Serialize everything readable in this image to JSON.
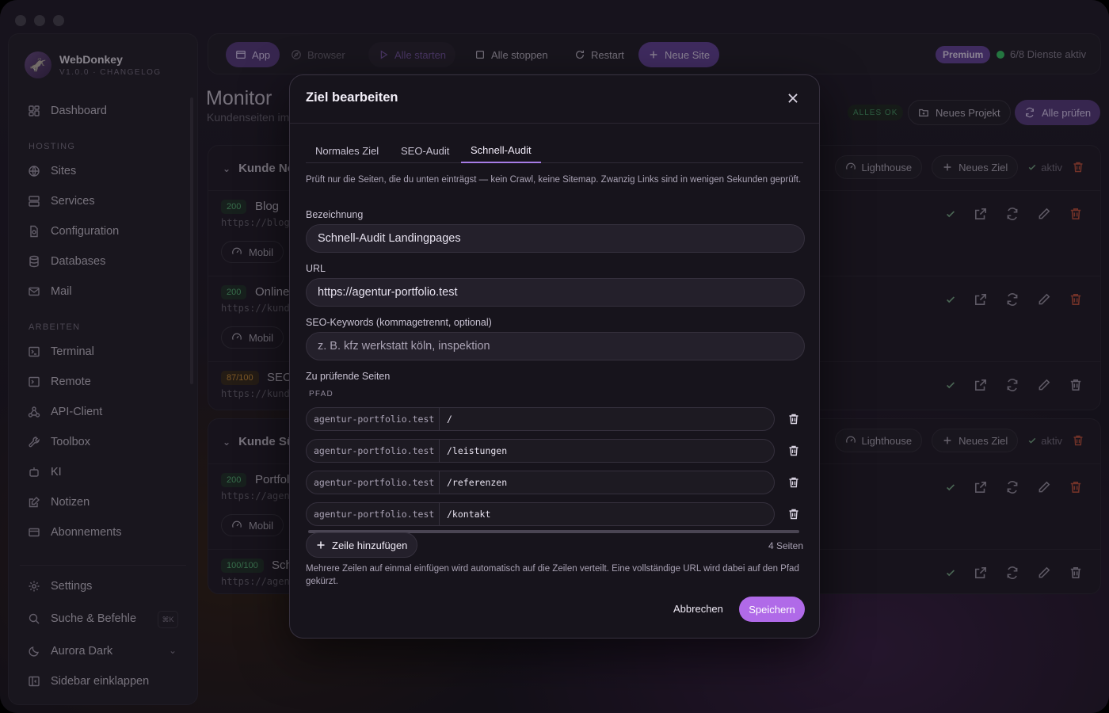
{
  "sidebar": {
    "app_name": "WebDonkey",
    "version": "V1.0.0 · CHANGELOG",
    "dashboard": "Dashboard",
    "section_hosting": "HOSTING",
    "sites": "Sites",
    "services": "Services",
    "configuration": "Configuration",
    "databases": "Databases",
    "mail": "Mail",
    "section_arbeiten": "ARBEITEN",
    "terminal": "Terminal",
    "remote": "Remote",
    "api_client": "API-Client",
    "toolbox": "Toolbox",
    "ki": "KI",
    "notizen": "Notizen",
    "abonnements": "Abonnements",
    "settings": "Settings",
    "search": "Suche & Befehle",
    "search_kbd": "⌘K",
    "theme": "Aurora Dark",
    "collapse": "Sidebar einklappen"
  },
  "toolbar": {
    "app": "App",
    "browser": "Browser",
    "start_all": "Alle starten",
    "stop_all": "Alle stoppen",
    "restart": "Restart",
    "new_site": "Neue Site",
    "premium": "Premium",
    "services_active": "6/8 Dienste aktiv"
  },
  "page": {
    "title": "Monitor",
    "subtitle": "Kundenseiten im",
    "status": "ALLES OK",
    "new_project": "Neues Projekt",
    "check_all": "Alle prüfen"
  },
  "groups": [
    {
      "name": "Kunde No",
      "lighthouse": "Lighthouse",
      "new_target": "Neues Ziel",
      "active": "aktiv",
      "rows": [
        {
          "status": "200",
          "name": "Blog",
          "extra": "1",
          "url": "https://blog.",
          "mode": "Mobil"
        },
        {
          "status": "200",
          "name": "Online",
          "url": "https://kunde",
          "mode": "Mobil"
        },
        {
          "status": "87/100",
          "name": "SEO",
          "url": "https://kunde"
        }
      ]
    },
    {
      "name": "Kunde Sü",
      "lighthouse": "Lighthouse",
      "new_target": "Neues Ziel",
      "active": "aktiv",
      "rows": [
        {
          "status": "200",
          "name": "Portfol",
          "url": "https://agent",
          "mode": "Mobil"
        },
        {
          "status": "100/100",
          "name": "Sch",
          "url": "https://agent"
        }
      ]
    }
  ],
  "modal": {
    "title": "Ziel bearbeiten",
    "tabs": [
      "Normales Ziel",
      "SEO-Audit",
      "Schnell-Audit"
    ],
    "active_tab": "Schnell-Audit",
    "description": "Prüft nur die Seiten, die du unten einträgst — kein Crawl, keine Sitemap. Zwanzig Links sind in wenigen Sekunden geprüft.",
    "name_label": "Bezeichnung",
    "name_value": "Schnell-Audit Landingpages",
    "url_label": "URL",
    "url_value": "https://agentur-portfolio.test",
    "keywords_label": "SEO-Keywords (kommagetrennt, optional)",
    "keywords_placeholder": "z. B. kfz werkstatt köln, inspektion",
    "pages_label": "Zu prüfende Seiten",
    "path_header": "PFAD",
    "pages": [
      {
        "domain": "agentur-portfolio.test",
        "path": "/"
      },
      {
        "domain": "agentur-portfolio.test",
        "path": "/leistungen"
      },
      {
        "domain": "agentur-portfolio.test",
        "path": "/referenzen"
      },
      {
        "domain": "agentur-portfolio.test",
        "path": "/kontakt"
      }
    ],
    "add_row": "Zeile hinzufügen",
    "page_count": "4 Seiten",
    "hint": "Mehrere Zeilen auf einmal einfügen wird automatisch auf die Zeilen verteilt. Eine vollständige URL wird dabei auf den Pfad gekürzt.",
    "cancel": "Abbrechen",
    "save": "Speichern"
  },
  "colors": {
    "accent": "#b06ae8",
    "accent_dark": "#6a47a3",
    "ok_green": "#3ad06b",
    "danger": "#c7553f"
  }
}
